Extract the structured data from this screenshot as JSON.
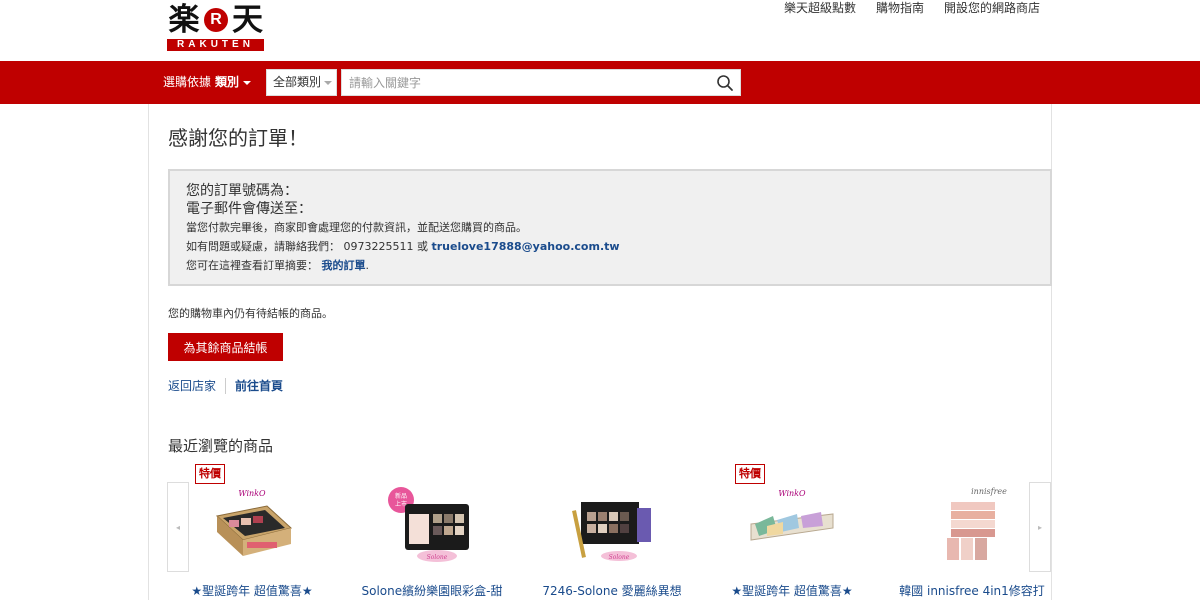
{
  "header": {
    "logo_kanji_left": "楽",
    "logo_r": "R",
    "logo_kanji_right": "天",
    "logo_text": "RAKUTEN",
    "links": [
      "樂天超級點數",
      "購物指南",
      "開設您的網路商店"
    ]
  },
  "searchbar": {
    "browse_label": "選購依據",
    "browse_bold": "類別",
    "category_selected": "全部類別",
    "placeholder": "請輸入關鍵字"
  },
  "confirmation": {
    "title": "感謝您的訂單！",
    "order_number_label": "您的訂單號碼為：",
    "email_label": "電子郵件會傳送至：",
    "payment_note": "當您付款完畢後，商家即會處理您的付款資訊，並配送您購買的商品。",
    "contact_prefix": "如有問題或疑慮，請聯絡我們： 0973225511 或 ",
    "contact_email": "truelove17888@yahoo.com.tw",
    "summary_prefix": "您可在這裡查看訂單摘要： ",
    "summary_link": "我的訂單",
    "summary_suffix": "."
  },
  "cart": {
    "note": "您的購物車內仍有待結帳的商品。",
    "checkout_button": "為其餘商品結帳"
  },
  "nav_links": {
    "back_to_shop": "返回店家",
    "go_home": "前往首頁"
  },
  "recent": {
    "title": "最近瀏覽的商品",
    "prev_arrow": "◂",
    "next_arrow": "▸",
    "items": [
      {
        "name": "★聖誕跨年 超值驚喜★",
        "badge": "特價",
        "brand": "WinkO"
      },
      {
        "name": "Solone繽紛樂園眼彩盒-甜",
        "badge": "",
        "brand": "Solone"
      },
      {
        "name": "7246-Solone 愛麗絲異想",
        "badge": "",
        "brand": "Solone"
      },
      {
        "name": "★聖誕跨年 超值驚喜★",
        "badge": "特價",
        "brand": "WinkO"
      },
      {
        "name": "韓國 innisfree 4in1修容打",
        "badge": "",
        "brand": "innisfree"
      }
    ]
  },
  "colors": {
    "brand_red": "#bf0000",
    "link_blue": "#1a4b8c"
  }
}
